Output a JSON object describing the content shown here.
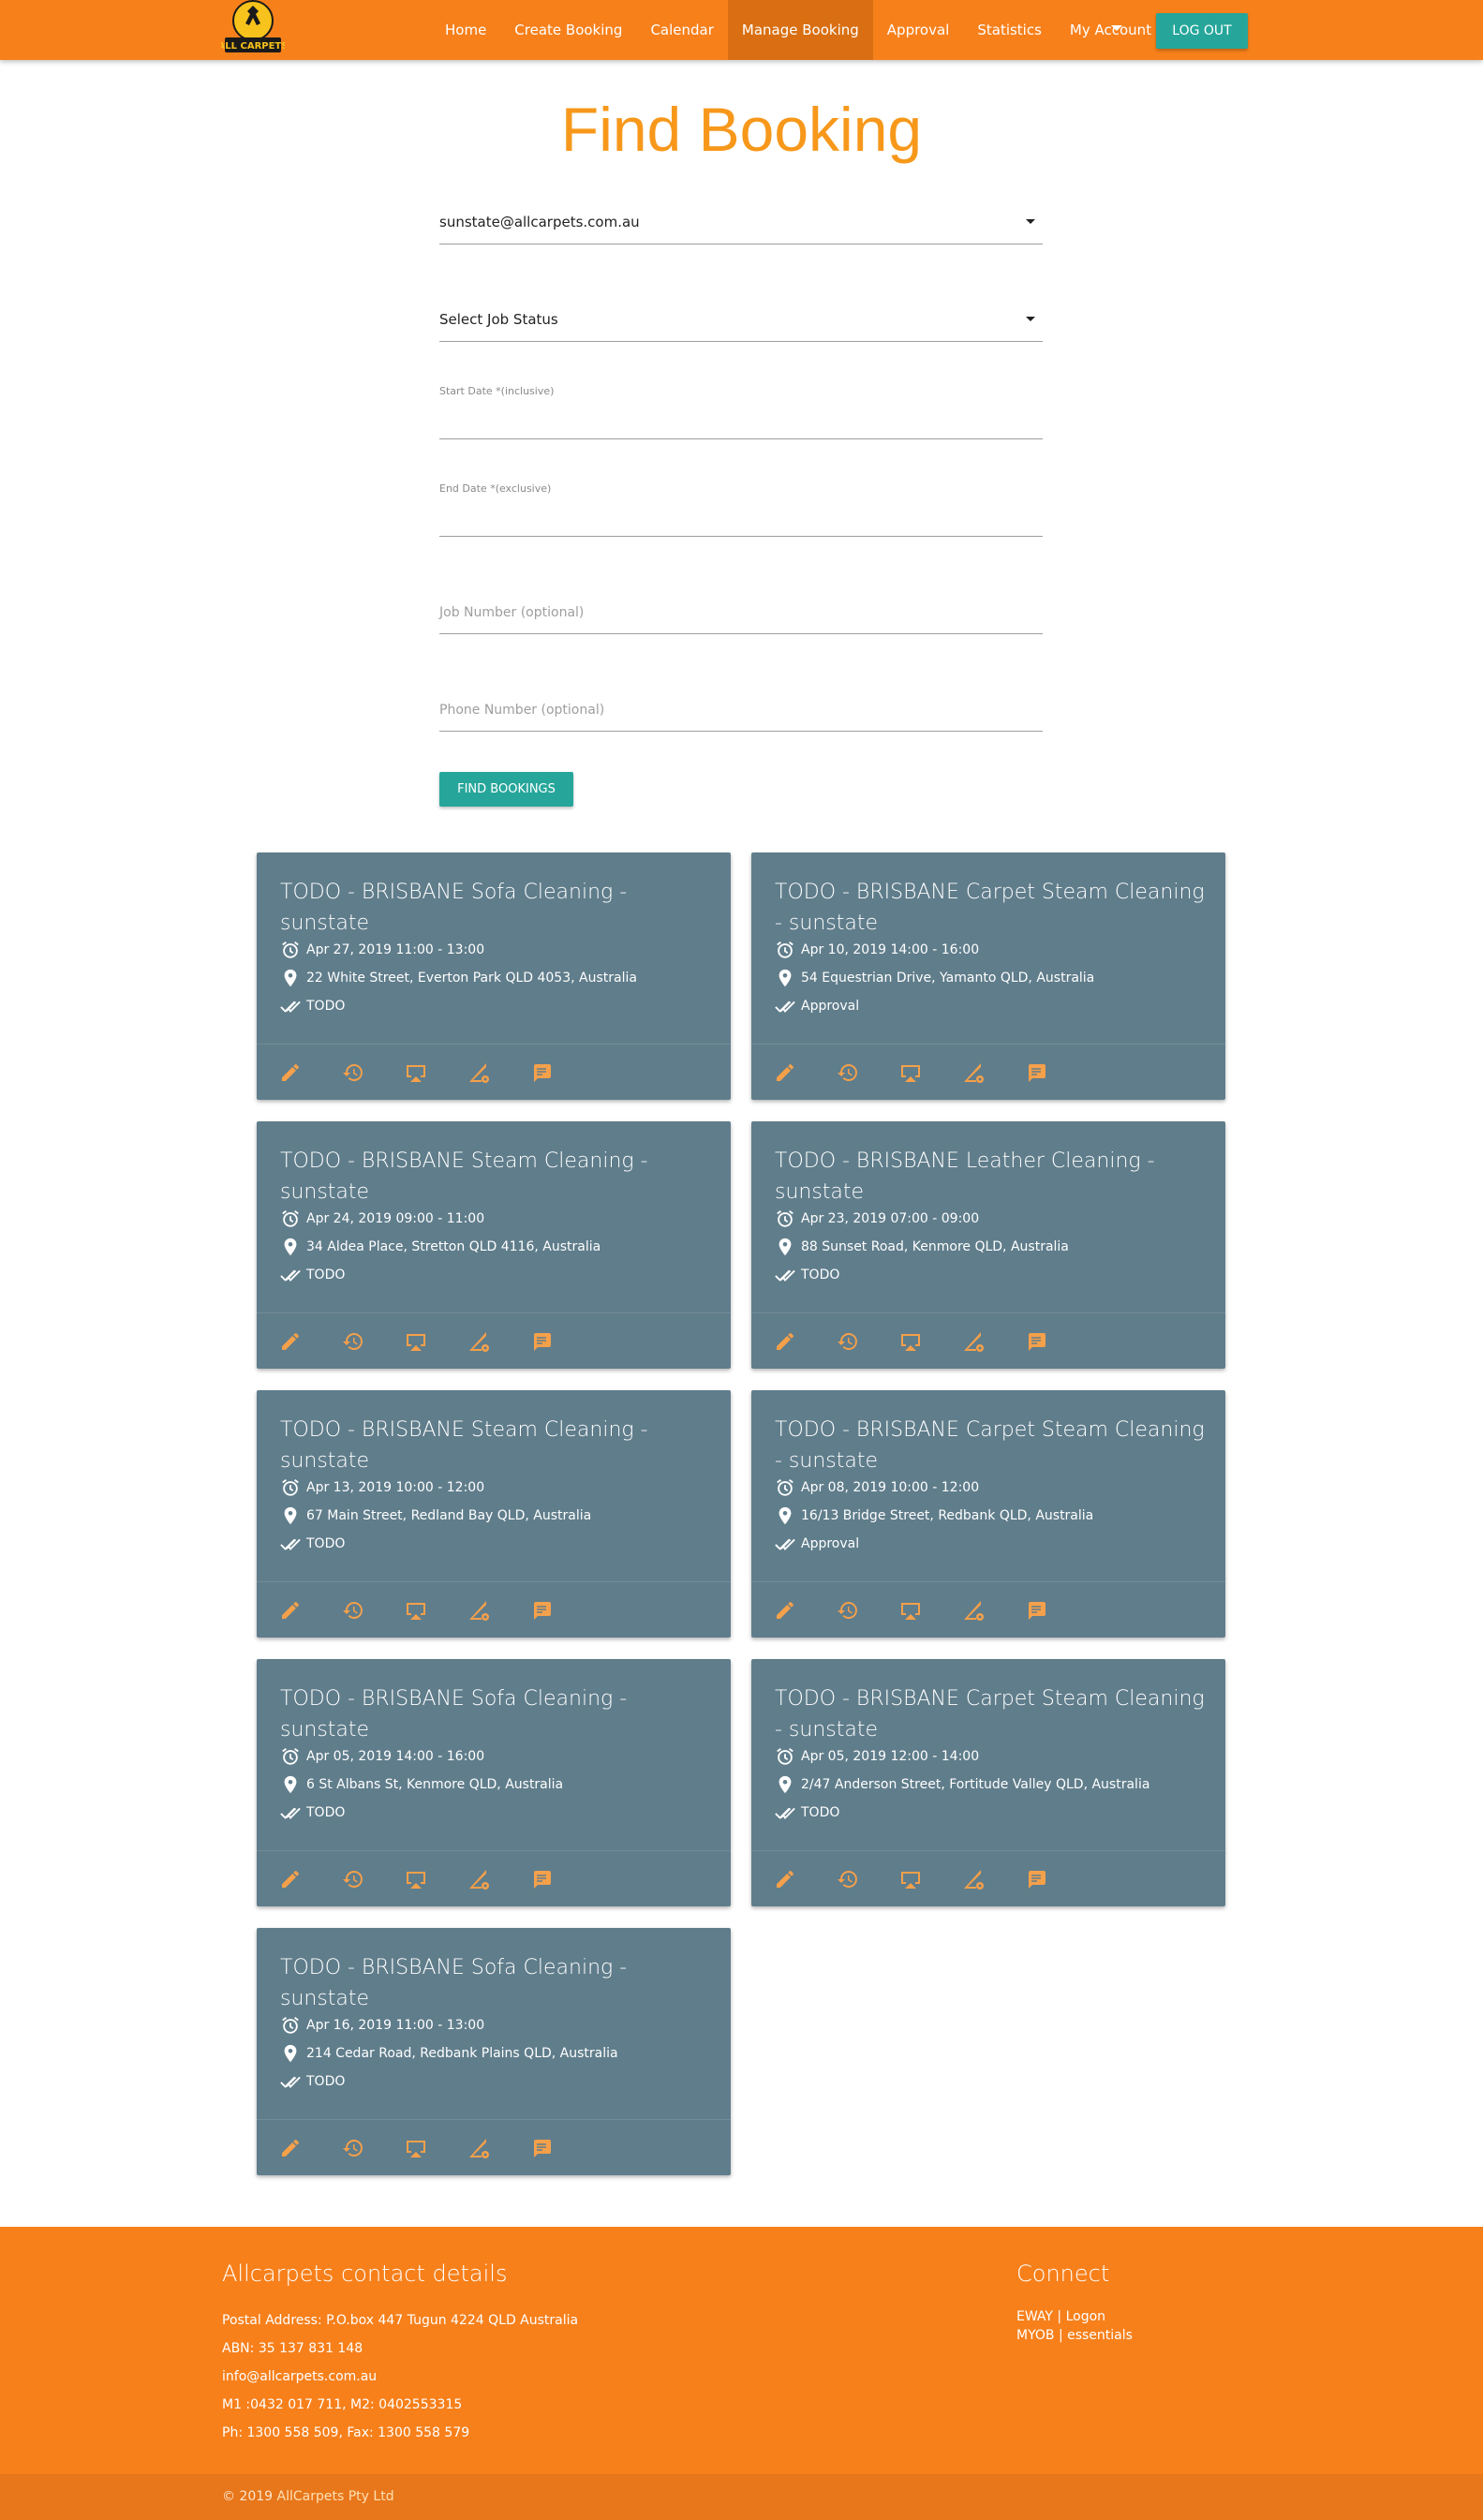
{
  "nav": {
    "logo_text": "ALL CARPETS",
    "items": [
      {
        "label": "Home"
      },
      {
        "label": "Create Booking"
      },
      {
        "label": "Calendar"
      },
      {
        "label": "Manage Booking",
        "active": true
      },
      {
        "label": "Approval"
      },
      {
        "label": "Statistics"
      },
      {
        "label": "My Account"
      }
    ],
    "logout_label": "LOG OUT"
  },
  "form": {
    "title": "Find Booking",
    "email_select": "sunstate@allcarpets.com.au",
    "status_select": "Select Job Status",
    "start_date_label": "Start Date *(inclusive)",
    "end_date_label": "End Date *(exclusive)",
    "job_number_placeholder": "Job Number (optional)",
    "phone_placeholder": "Phone Number (optional)",
    "find_label": "FIND BOOKINGS"
  },
  "cards": [
    {
      "title": "TODO - BRISBANE Sofa Cleaning - sunstate",
      "time": "Apr 27, 2019 11:00 - 13:00",
      "address": "22 White Street, Everton Park QLD 4053, Australia",
      "status": "TODO"
    },
    {
      "title": "TODO - BRISBANE Carpet Steam Cleaning - sunstate",
      "time": "Apr 10, 2019 14:00 - 16:00",
      "address": "54 Equestrian Drive, Yamanto QLD, Australia",
      "status": "Approval"
    },
    {
      "title": "TODO - BRISBANE Steam Cleaning - sunstate",
      "time": "Apr 24, 2019 09:00 - 11:00",
      "address": "34 Aldea Place, Stretton QLD 4116, Australia",
      "status": "TODO"
    },
    {
      "title": "TODO - BRISBANE Leather Cleaning - sunstate",
      "time": "Apr 23, 2019 07:00 - 09:00",
      "address": "88 Sunset Road, Kenmore QLD, Australia",
      "status": "TODO"
    },
    {
      "title": "TODO - BRISBANE Steam Cleaning - sunstate",
      "time": "Apr 13, 2019 10:00 - 12:00",
      "address": "67 Main Street, Redland Bay QLD, Australia",
      "status": "TODO"
    },
    {
      "title": "TODO - BRISBANE Carpet Steam Cleaning - sunstate",
      "time": "Apr 08, 2019 10:00 - 12:00",
      "address": "16/13 Bridge Street, Redbank QLD, Australia",
      "status": "Approval"
    },
    {
      "title": "TODO - BRISBANE Sofa Cleaning - sunstate",
      "time": "Apr 05, 2019 14:00 - 16:00",
      "address": "6 St Albans St, Kenmore QLD, Australia",
      "status": "TODO"
    },
    {
      "title": "TODO - BRISBANE Carpet Steam Cleaning - sunstate",
      "time": "Apr 05, 2019 12:00 - 14:00",
      "address": "2/47 Anderson Street, Fortitude Valley QLD, Australia",
      "status": "TODO"
    },
    {
      "title": "TODO - BRISBANE Sofa Cleaning - sunstate",
      "time": "Apr 16, 2019 11:00 - 13:00",
      "address": "214 Cedar Road, Redbank Plains QLD, Australia",
      "status": "TODO"
    }
  ],
  "card_actions": [
    "pencil-icon",
    "history-icon",
    "airplay-icon",
    "signal-cellular-icon",
    "comment-icon"
  ],
  "footer": {
    "contact_heading": "Allcarpets contact details",
    "postal": "Postal Address: P.O.box 447 Tugun 4224 QLD Australia",
    "abn": "ABN: 35 137 831 148",
    "email": "info@allcarpets.com.au",
    "mobile": "M1 :0432 017 711, M2: 0402553315",
    "phone": "Ph: 1300 558 509, Fax: 1300 558 579",
    "connect_heading": "Connect",
    "eway": "EWAY | Logon",
    "myob": "MYOB | essentials",
    "copyright_prefix": "© 2019 ",
    "copyright_brand": "AllCarpets Pty Ltd"
  },
  "colors": {
    "brand_orange": "#f7801b",
    "title_orange": "#f7981b",
    "teal": "#26a69a",
    "card_bg": "#607d8b",
    "icon_accent": "#f5a04a"
  }
}
